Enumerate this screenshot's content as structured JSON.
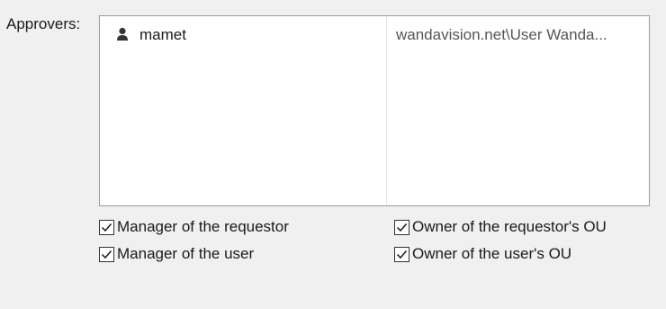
{
  "approvers": {
    "label": "Approvers:",
    "list": [
      {
        "icon": "user-icon",
        "name": "mamet",
        "domain": "wandavision.net\\User Wanda..."
      }
    ]
  },
  "checkboxes": [
    {
      "label": "Manager of the requestor",
      "checked": true
    },
    {
      "label": "Manager of the user",
      "checked": true
    },
    {
      "label": "Owner of the requestor's OU",
      "checked": true
    },
    {
      "label": "Owner of the user's OU",
      "checked": true
    }
  ],
  "colors": {
    "background": "#f0f0f0",
    "list_background": "#ffffff",
    "border": "#9a9a9a",
    "secondary_text": "#555555"
  }
}
